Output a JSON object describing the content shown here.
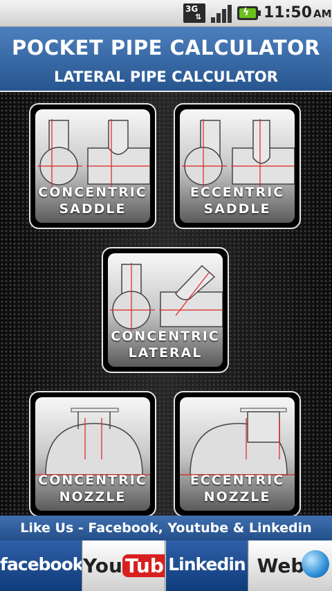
{
  "status_bar": {
    "network": "3G",
    "time": "11:50",
    "ampm": "AM",
    "icons": [
      "3g-data-icon",
      "signal-icon",
      "battery-charging-icon"
    ]
  },
  "header": {
    "title": "POCKET PIPE CALCULATOR",
    "subtitle": "LATERAL PIPE CALCULATOR"
  },
  "tiles": [
    {
      "id": "concentric-saddle",
      "line1": "CONCENTRIC",
      "line2": "SADDLE"
    },
    {
      "id": "eccentric-saddle",
      "line1": "ECCENTRIC",
      "line2": "SADDLE"
    },
    {
      "id": "concentric-lateral",
      "line1": "CONCENTRIC",
      "line2": "LATERAL"
    },
    {
      "id": "concentric-nozzle",
      "line1": "CONCENTRIC",
      "line2": "NOZZLE"
    },
    {
      "id": "eccentric-nozzle",
      "line1": "ECCENTRIC",
      "line2": "NOZZLE"
    }
  ],
  "footer": {
    "like_text": "Like Us - Facebook, Youtube & Linkedin",
    "facebook": "facebook",
    "youtube_you": "You",
    "youtube_tube": "Tube",
    "linkedin": "Linkedin",
    "web": "Web"
  },
  "colors": {
    "header_blue": "#27568f",
    "guide_red": "#e02020",
    "battery_green": "#6cc01b"
  }
}
